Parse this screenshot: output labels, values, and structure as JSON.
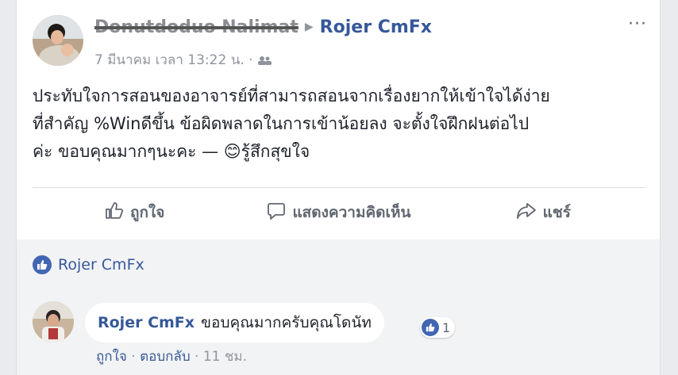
{
  "post": {
    "author_name": "Donutdoduo Nalimat",
    "target": "Rojer CmFx",
    "timestamp": "7 มีนาคม เวลา 13:22 น.",
    "separator": "·",
    "menu": "···",
    "text_lines": [
      "ประทับใจการสอนของอาจารย์ที่สามารถสอนจากเรื่องยากให้เข้าใจได้ง่าย",
      "ที่สำคัญ %Winดีขึ้น ข้อผิดพลาดในการเข้าน้อยลง จะตั้งใจฝึกฝนต่อไป",
      "ค่ะ ขอบคุณมากๆนะคะ — 😊รู้สึกสุขใจ"
    ]
  },
  "actions": {
    "like": "ถูกใจ",
    "comment": "แสดงความคิดเห็น",
    "share": "แชร์"
  },
  "likes": {
    "name": "Rojer CmFx"
  },
  "comment": {
    "author": "Rojer CmFx",
    "text": "ขอบคุณมากครับคุณโดนัท",
    "reaction_count": "1",
    "like_label": "ถูกใจ",
    "reply_label": "ตอบกลับ",
    "sep1": "·",
    "sep2": "·",
    "time": "11 ชม."
  },
  "colors": {
    "link": "#365899",
    "accent": "#4267b2",
    "muted": "#90949c"
  }
}
